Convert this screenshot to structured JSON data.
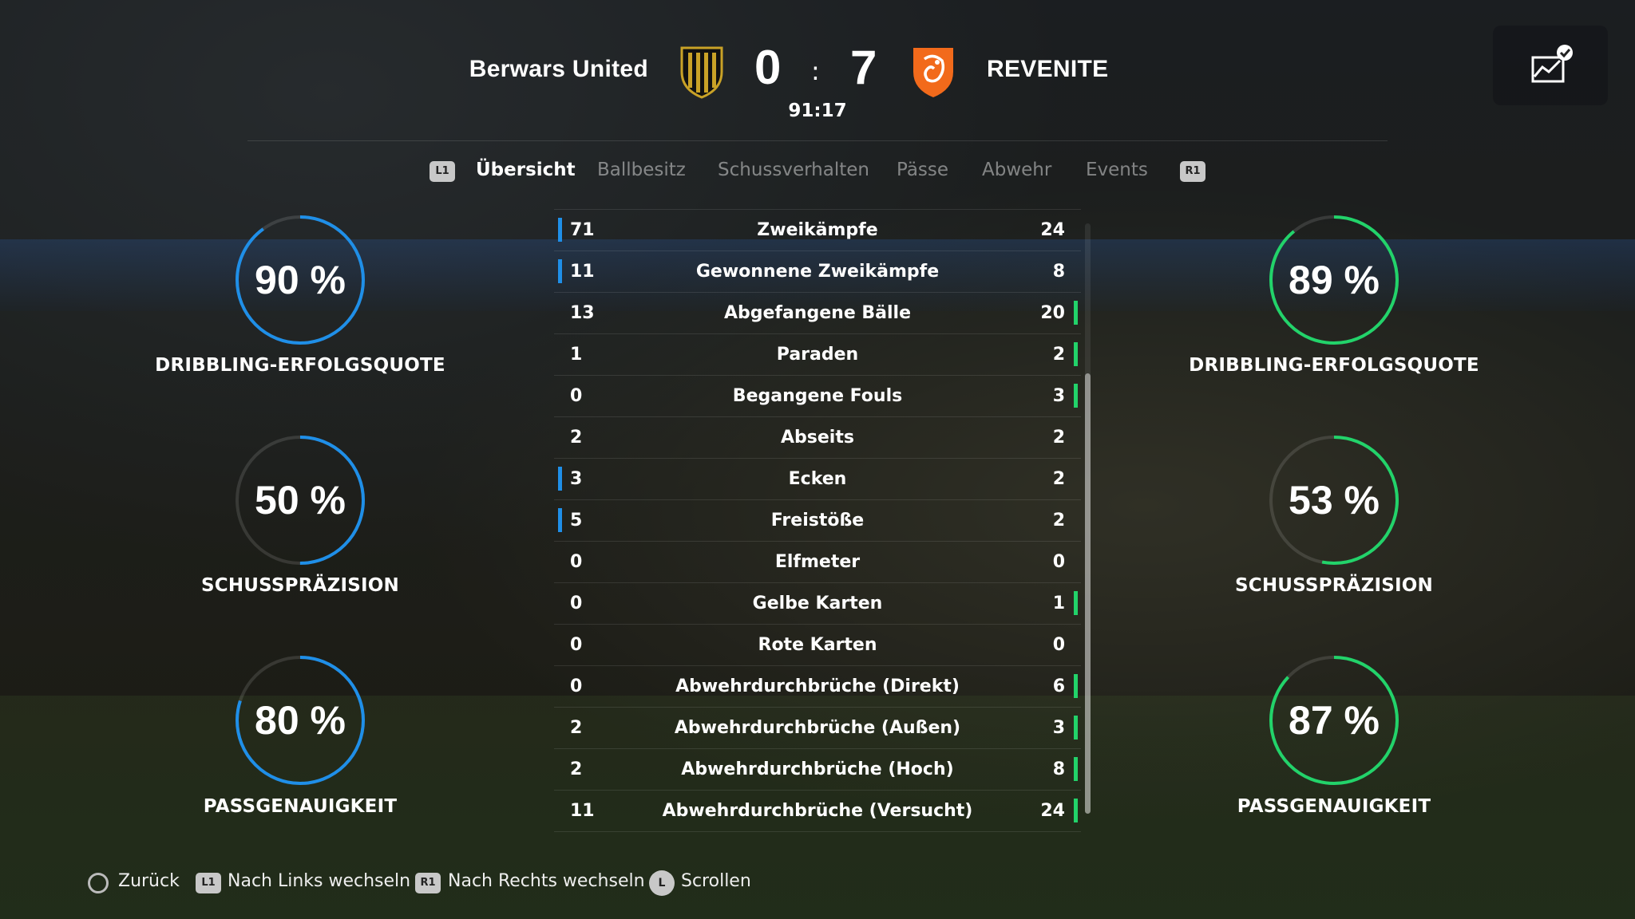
{
  "header": {
    "home_team": "Berwars United",
    "away_team": "REVENITE",
    "home_score": "0",
    "separator": ":",
    "away_score": "7",
    "match_clock": "91:17",
    "home_crest_icon": "shield-crest-black-gold",
    "away_crest_icon": "lion-crest-orange",
    "stats_icon": "chart-check-icon"
  },
  "tabs": {
    "left_button": "L1",
    "right_button": "R1",
    "items": [
      "Übersicht",
      "Ballbesitz",
      "Schussverhalten",
      "Pässe",
      "Abwehr",
      "Events"
    ],
    "active_index": 0
  },
  "left_rings": [
    {
      "value": "90 %",
      "label": "DRIBBLING-ERFOLGSQUOTE",
      "fraction": 0.9
    },
    {
      "value": "50 %",
      "label": "SCHUSSPRÄZISION",
      "fraction": 0.5
    },
    {
      "value": "80 %",
      "label": "PASSGENAUIGKEIT",
      "fraction": 0.8
    }
  ],
  "right_rings": [
    {
      "value": "89 %",
      "label": "DRIBBLING-ERFOLGSQUOTE",
      "fraction": 0.89
    },
    {
      "value": "53 %",
      "label": "SCHUSSPRÄZISION",
      "fraction": 0.53
    },
    {
      "value": "87 %",
      "label": "PASSGENAUIGKEIT",
      "fraction": 0.87
    }
  ],
  "stats": [
    {
      "home": "71",
      "label": "Zweikämpfe",
      "away": "24",
      "leader": "home"
    },
    {
      "home": "11",
      "label": "Gewonnene Zweikämpfe",
      "away": "8",
      "leader": "home"
    },
    {
      "home": "13",
      "label": "Abgefangene Bälle",
      "away": "20",
      "leader": "away"
    },
    {
      "home": "1",
      "label": "Paraden",
      "away": "2",
      "leader": "away"
    },
    {
      "home": "0",
      "label": "Begangene Fouls",
      "away": "3",
      "leader": "away"
    },
    {
      "home": "2",
      "label": "Abseits",
      "away": "2",
      "leader": "none"
    },
    {
      "home": "3",
      "label": "Ecken",
      "away": "2",
      "leader": "home"
    },
    {
      "home": "5",
      "label": "Freistöße",
      "away": "2",
      "leader": "home"
    },
    {
      "home": "0",
      "label": "Elfmeter",
      "away": "0",
      "leader": "none"
    },
    {
      "home": "0",
      "label": "Gelbe Karten",
      "away": "1",
      "leader": "away"
    },
    {
      "home": "0",
      "label": "Rote Karten",
      "away": "0",
      "leader": "none"
    },
    {
      "home": "0",
      "label": "Abwehrdurchbrüche (Direkt)",
      "away": "6",
      "leader": "away"
    },
    {
      "home": "2",
      "label": "Abwehrdurchbrüche (Außen)",
      "away": "3",
      "leader": "away"
    },
    {
      "home": "2",
      "label": "Abwehrdurchbrüche (Hoch)",
      "away": "8",
      "leader": "away"
    },
    {
      "home": "11",
      "label": "Abwehrdurchbrüche (Versucht)",
      "away": "24",
      "leader": "away"
    }
  ],
  "footer": {
    "back": "Zurück",
    "prev_button": "L1",
    "prev": "Nach Links wechseln",
    "next_button": "R1",
    "next": "Nach Rechts wechseln",
    "scroll_button": "L",
    "scroll": "Scrollen"
  },
  "colors": {
    "home_accent": "#1f8fe8",
    "away_accent": "#22d36a"
  }
}
